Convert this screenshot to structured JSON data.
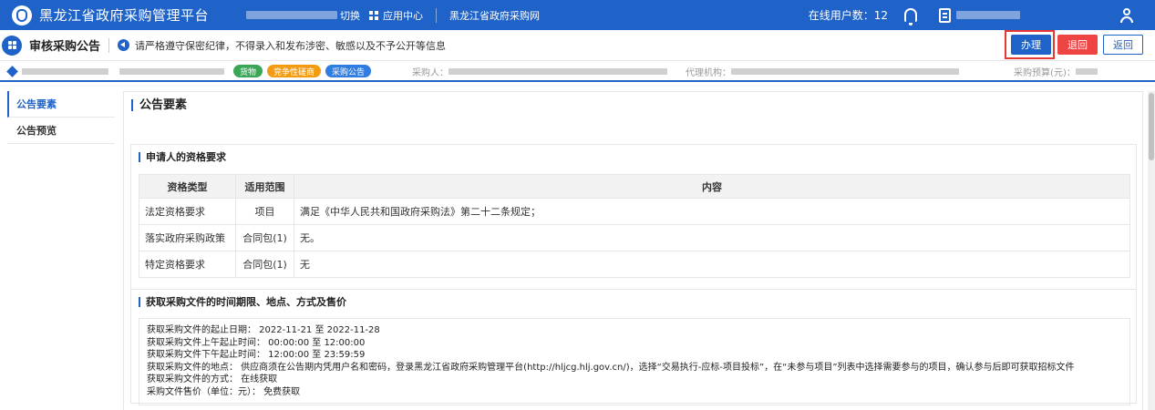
{
  "topbar": {
    "title": "黑龙江省政府采购管理平台",
    "switch_label": "切换",
    "app_center": "应用中心",
    "site_link": "黑龙江省政府采购网",
    "online_users_label": "在线用户数：",
    "online_users_count": "12"
  },
  "header": {
    "page_title": "审核采购公告",
    "notice": "请严格遵守保密纪律，不得录入和发布涉密、敏感以及不予公开等信息",
    "btn_handle": "办理",
    "btn_reject": "退回",
    "btn_back": "返回"
  },
  "info": {
    "tags": [
      "货物",
      "竞争性磋商",
      "采购公告"
    ],
    "purchaser_label": "采购人：",
    "agency_label": "代理机构：",
    "budget_label": "采购预算(元)："
  },
  "nav": {
    "items": [
      "公告要素",
      "公告预览"
    ]
  },
  "main": {
    "title": "公告要素",
    "qualification": {
      "title": "申请人的资格要求",
      "headers": [
        "资格类型",
        "适用范围",
        "内容"
      ],
      "rows": [
        [
          "法定资格要求",
          "项目",
          "满足《中华人民共和国政府采购法》第二十二条规定；"
        ],
        [
          "落实政府采购政策",
          "合同包(1)",
          "无。"
        ],
        [
          "特定资格要求",
          "合同包(1)",
          "无"
        ]
      ]
    },
    "obtain": {
      "title": "获取采购文件的时间期限、地点、方式及售价",
      "lines": [
        "获取采购文件的起止日期： 2022-11-21 至 2022-11-28",
        "获取采购文件上午起止时间： 00:00:00 至 12:00:00",
        "获取采购文件下午起止时间： 12:00:00 至 23:59:59",
        "获取采购文件的地点： 供应商须在公告期内凭用户名和密码，登录黑龙江省政府采购管理平台(http://hljcg.hlj.gov.cn/)，选择“交易执行-应标-项目投标”，在“未参与项目”列表中选择需要参与的项目，确认参与后即可获取招标文件",
        "获取采购文件的方式： 在线获取",
        "采购文件售价（单位：元）： 免费获取"
      ]
    }
  }
}
